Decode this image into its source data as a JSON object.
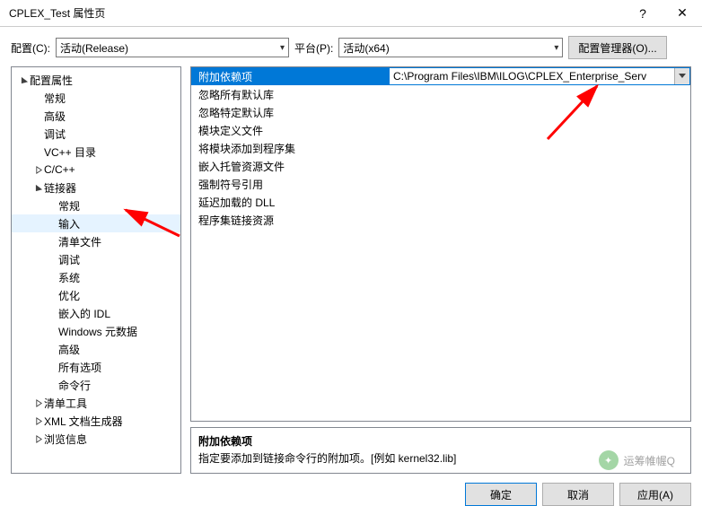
{
  "window": {
    "title": "CPLEX_Test 属性页",
    "help": "?",
    "close": "✕"
  },
  "topbar": {
    "config_label": "配置(C):",
    "config_value": "活动(Release)",
    "platform_label": "平台(P):",
    "platform_value": "活动(x64)",
    "manager_btn": "配置管理器(O)..."
  },
  "tree": [
    {
      "label": "配置属性",
      "level": 0,
      "expand": "open"
    },
    {
      "label": "常规",
      "level": 1
    },
    {
      "label": "高级",
      "level": 1
    },
    {
      "label": "调试",
      "level": 1
    },
    {
      "label": "VC++ 目录",
      "level": 1
    },
    {
      "label": "C/C++",
      "level": 1,
      "expand": "closed"
    },
    {
      "label": "链接器",
      "level": 1,
      "expand": "open"
    },
    {
      "label": "常规",
      "level": 2
    },
    {
      "label": "输入",
      "level": 2,
      "selected": true
    },
    {
      "label": "清单文件",
      "level": 2
    },
    {
      "label": "调试",
      "level": 2
    },
    {
      "label": "系统",
      "level": 2
    },
    {
      "label": "优化",
      "level": 2
    },
    {
      "label": "嵌入的 IDL",
      "level": 2
    },
    {
      "label": "Windows 元数据",
      "level": 2
    },
    {
      "label": "高级",
      "level": 2
    },
    {
      "label": "所有选项",
      "level": 2
    },
    {
      "label": "命令行",
      "level": 2
    },
    {
      "label": "清单工具",
      "level": 1,
      "expand": "closed"
    },
    {
      "label": "XML 文档生成器",
      "level": 1,
      "expand": "closed"
    },
    {
      "label": "浏览信息",
      "level": 1,
      "expand": "closed"
    }
  ],
  "props": [
    {
      "name": "附加依赖项",
      "value": "C:\\Program Files\\IBM\\ILOG\\CPLEX_Enterprise_Serv",
      "selected": true
    },
    {
      "name": "忽略所有默认库",
      "value": ""
    },
    {
      "name": "忽略特定默认库",
      "value": ""
    },
    {
      "name": "模块定义文件",
      "value": ""
    },
    {
      "name": "将模块添加到程序集",
      "value": ""
    },
    {
      "name": "嵌入托管资源文件",
      "value": ""
    },
    {
      "name": "强制符号引用",
      "value": ""
    },
    {
      "name": "延迟加载的 DLL",
      "value": ""
    },
    {
      "name": "程序集链接资源",
      "value": ""
    }
  ],
  "desc": {
    "title": "附加依赖项",
    "body": "指定要添加到链接命令行的附加项。[例如 kernel32.lib]"
  },
  "buttons": {
    "ok": "确定",
    "cancel": "取消",
    "apply": "应用(A)"
  },
  "watermark": "运筹帷幄Q"
}
